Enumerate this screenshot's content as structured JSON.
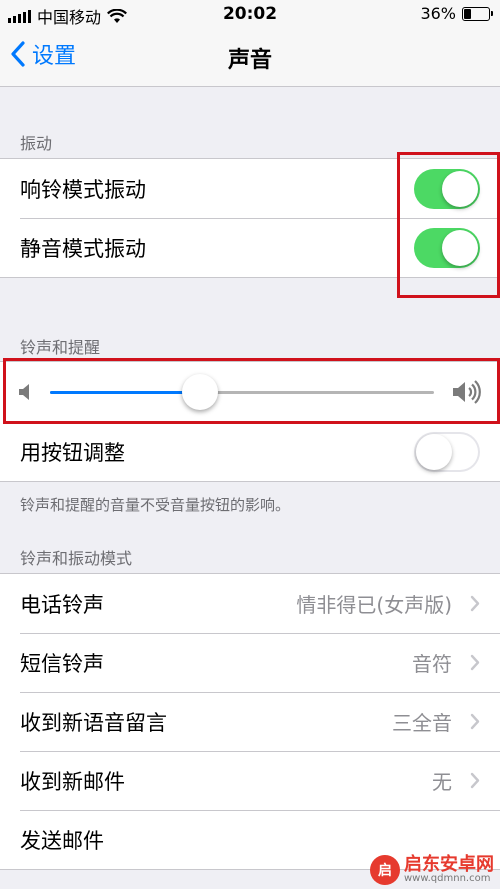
{
  "status_bar": {
    "carrier": "中国移动",
    "time": "20:02",
    "battery": "36%",
    "battery_level": 0.36
  },
  "nav": {
    "back_label": "设置",
    "title": "声音"
  },
  "vibration": {
    "header": "振动",
    "items": [
      {
        "label": "响铃模式振动",
        "on": true
      },
      {
        "label": "静音模式振动",
        "on": true
      }
    ]
  },
  "ringer": {
    "header": "铃声和提醒",
    "volume_level": 0.39,
    "adjust_label": "用按钮调整",
    "adjust_on": false,
    "note": "铃声和提醒的音量不受音量按钮的影响。"
  },
  "patterns": {
    "header": "铃声和振动模式",
    "items": [
      {
        "label": "电话铃声",
        "value": "情非得已(女声版)"
      },
      {
        "label": "短信铃声",
        "value": "音符"
      },
      {
        "label": "收到新语音留言",
        "value": "三全音"
      },
      {
        "label": "收到新邮件",
        "value": "无"
      },
      {
        "label": "发送邮件",
        "value": ""
      }
    ]
  },
  "watermark": {
    "name": "启东安卓网",
    "url": "www.qdmnn.com",
    "logo_glyph": "启"
  },
  "colors": {
    "accent": "#0079fe",
    "toggle_on": "#4cd964",
    "annotation": "#d0111b"
  }
}
